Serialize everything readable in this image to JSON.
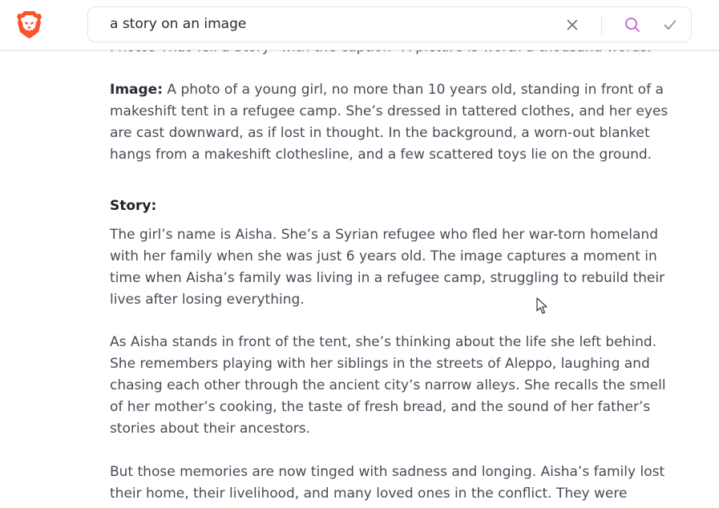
{
  "search": {
    "query": "a story on an image"
  },
  "icons": {
    "logo": "brave-lion-logo",
    "clear": "close-icon",
    "search": "search-icon",
    "submit": "check-icon"
  },
  "colors": {
    "brand": "#fb542b",
    "search_icon": "#c55ed6",
    "text": "#4a4a57"
  },
  "content": {
    "cut_line": "Photos That Tell a Story\" with the caption \"A picture is worth a thousand words.\"",
    "image_label": "Image:",
    "image_text": " A photo of a young girl, no more than 10 years old, standing in front of a makeshift tent in a refugee camp. She’s dressed in tattered clothes, and her eyes are cast downward, as if lost in thought. In the background, a worn-out blanket hangs from a makeshift clothesline, and a few scattered toys lie on the ground.",
    "story_heading": "Story:",
    "para1": "The girl’s name is Aisha. She’s a Syrian refugee who fled her war-torn homeland with her family when she was just 6 years old. The image captures a moment in time when Aisha’s family was living in a refugee camp, struggling to rebuild their lives after losing everything.",
    "para2": "As Aisha stands in front of the tent, she’s thinking about the life she left behind. She remembers playing with her siblings in the streets of Aleppo, laughing and chasing each other through the ancient city’s narrow alleys. She recalls the smell of her mother’s cooking, the taste of fresh bread, and the sound of her father’s stories about their ancestors.",
    "para3": "But those memories are now tinged with sadness and longing. Aisha’s family lost their home, their livelihood, and many loved ones in the conflict. They were forced"
  }
}
